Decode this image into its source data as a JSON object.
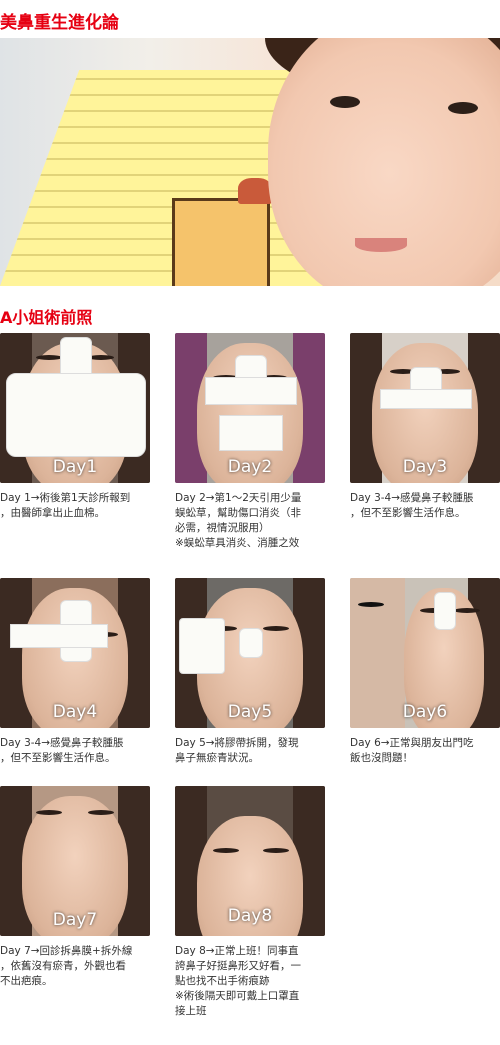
{
  "header": {
    "title": "美鼻重生進化論"
  },
  "section": {
    "title": "A小姐術前照"
  },
  "cards": [
    {
      "day": "Day1",
      "lines": [
        "Day 1→術後第1天診所報到",
        "，由醫師拿出止血棉。"
      ]
    },
    {
      "day": "Day2",
      "lines": [
        "Day 2→第1～2天引用少量",
        "蜈蚣草，幫助傷口消炎（非",
        "必需，視情況服用）",
        "※蜈蚣草具消炎、消腫之效"
      ]
    },
    {
      "day": "Day3",
      "lines": [
        "Day 3-4→感覺鼻子較腫脹",
        "，但不至影響生活作息。"
      ]
    },
    {
      "day": "Day4",
      "lines": [
        "Day 3-4→感覺鼻子較腫脹",
        "，但不至影響生活作息。"
      ]
    },
    {
      "day": "Day5",
      "lines": [
        "Day 5→將膠帶拆開，發現",
        "鼻子無瘀青狀況。"
      ]
    },
    {
      "day": "Day6",
      "lines": [
        "Day 6→正常與朋友出門吃",
        "飯也沒問題！"
      ]
    },
    {
      "day": "Day7",
      "lines": [
        "Day 7→回診拆鼻膜+拆外線",
        "，依舊沒有瘀青，外觀也看",
        "不出疤痕。"
      ]
    },
    {
      "day": "Day8",
      "lines": [
        "Day 8→正常上班！同事直",
        "誇鼻子好挺鼻形又好看，一",
        "點也找不出手術痕跡",
        "※術後隔天即可戴上口罩直",
        "接上班"
      ]
    }
  ],
  "colors": {
    "accent": "#e60012",
    "caption_text": "#333333"
  }
}
